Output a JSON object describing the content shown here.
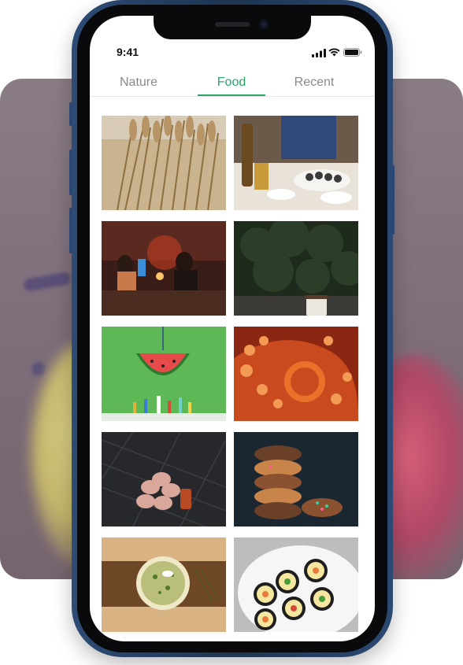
{
  "status_bar": {
    "time": "9:41",
    "icons": [
      "signal-icon",
      "wifi-icon",
      "battery-icon"
    ]
  },
  "tabs": [
    {
      "label": "Nature",
      "active": false
    },
    {
      "label": "Food",
      "active": true
    },
    {
      "label": "Recent",
      "active": false
    }
  ],
  "colors": {
    "accent": "#2aa56b",
    "inactive_tab": "#8a8a8a",
    "phone_frame": "#1e3553"
  },
  "photos": [
    {
      "subject": "wheat-bundle"
    },
    {
      "subject": "sushi-dinner"
    },
    {
      "subject": "restaurant-evening"
    },
    {
      "subject": "coffee-cup-bushes"
    },
    {
      "subject": "watermelon-pinata"
    },
    {
      "subject": "octopus-tentacles"
    },
    {
      "subject": "sausage-slices-grill"
    },
    {
      "subject": "donut-stack"
    },
    {
      "subject": "soup-bowl-board"
    },
    {
      "subject": "sushi-rolls-plate"
    }
  ]
}
